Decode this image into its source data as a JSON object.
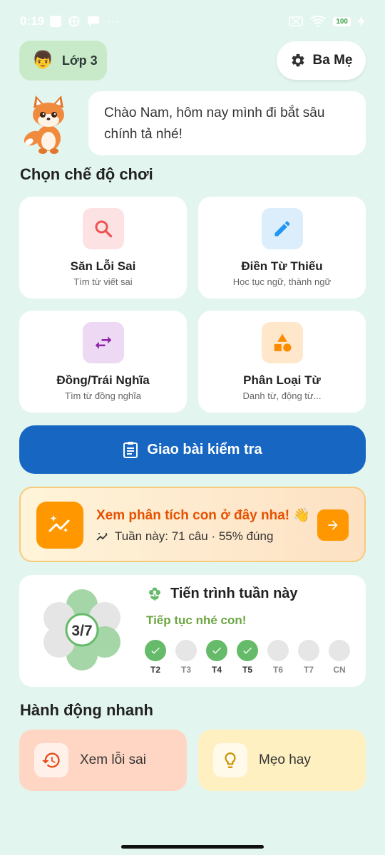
{
  "status_bar": {
    "time": "0:19",
    "battery": "100"
  },
  "header": {
    "class_label": "Lớp 3",
    "parent_label": "Ba Mẹ"
  },
  "greeting": {
    "text": "Chào Nam, hôm nay mình đi bắt sâu chính tả nhé!"
  },
  "modes": {
    "title": "Chọn chế độ chơi",
    "items": [
      {
        "title": "Săn Lỗi Sai",
        "subtitle": "Tìm từ viết sai",
        "icon": "search-icon",
        "color": "#EF5350",
        "bg": "#FDE2E4"
      },
      {
        "title": "Điền Từ Thiếu",
        "subtitle": "Học tục ngữ, thành ngữ",
        "icon": "pencil-icon",
        "color": "#2196F3",
        "bg": "#DCEEFC"
      },
      {
        "title": "Đồng/Trái Nghĩa",
        "subtitle": "Tìm từ đồng nghĩa",
        "icon": "swap-icon",
        "color": "#8E24AA",
        "bg": "#EDD9F3"
      },
      {
        "title": "Phân Loại Từ",
        "subtitle": "Danh từ, động từ...",
        "icon": "shapes-icon",
        "color": "#FB8C00",
        "bg": "#FFE7CC"
      }
    ]
  },
  "assign": {
    "label": "Giao bài kiểm tra"
  },
  "analytics": {
    "title": "Xem phân tích con ở đây nha! 👋",
    "subtitle": "Tuần này: 71 câu · 55% đúng"
  },
  "progress": {
    "title": "Tiến trình tuần này",
    "ratio": "3/7",
    "message": "Tiếp tục nhé con!",
    "days": [
      {
        "label": "T2",
        "done": true
      },
      {
        "label": "T3",
        "done": false
      },
      {
        "label": "T4",
        "done": true
      },
      {
        "label": "T5",
        "done": true
      },
      {
        "label": "T6",
        "done": false
      },
      {
        "label": "T7",
        "done": false
      },
      {
        "label": "CN",
        "done": false
      }
    ]
  },
  "quick_actions": {
    "title": "Hành động nhanh",
    "items": [
      {
        "label": "Xem lỗi sai",
        "icon": "history-icon",
        "bg": "#FFD6C4"
      },
      {
        "label": "Mẹo hay",
        "icon": "lightbulb-icon",
        "bg": "#FFF0C2"
      }
    ]
  }
}
